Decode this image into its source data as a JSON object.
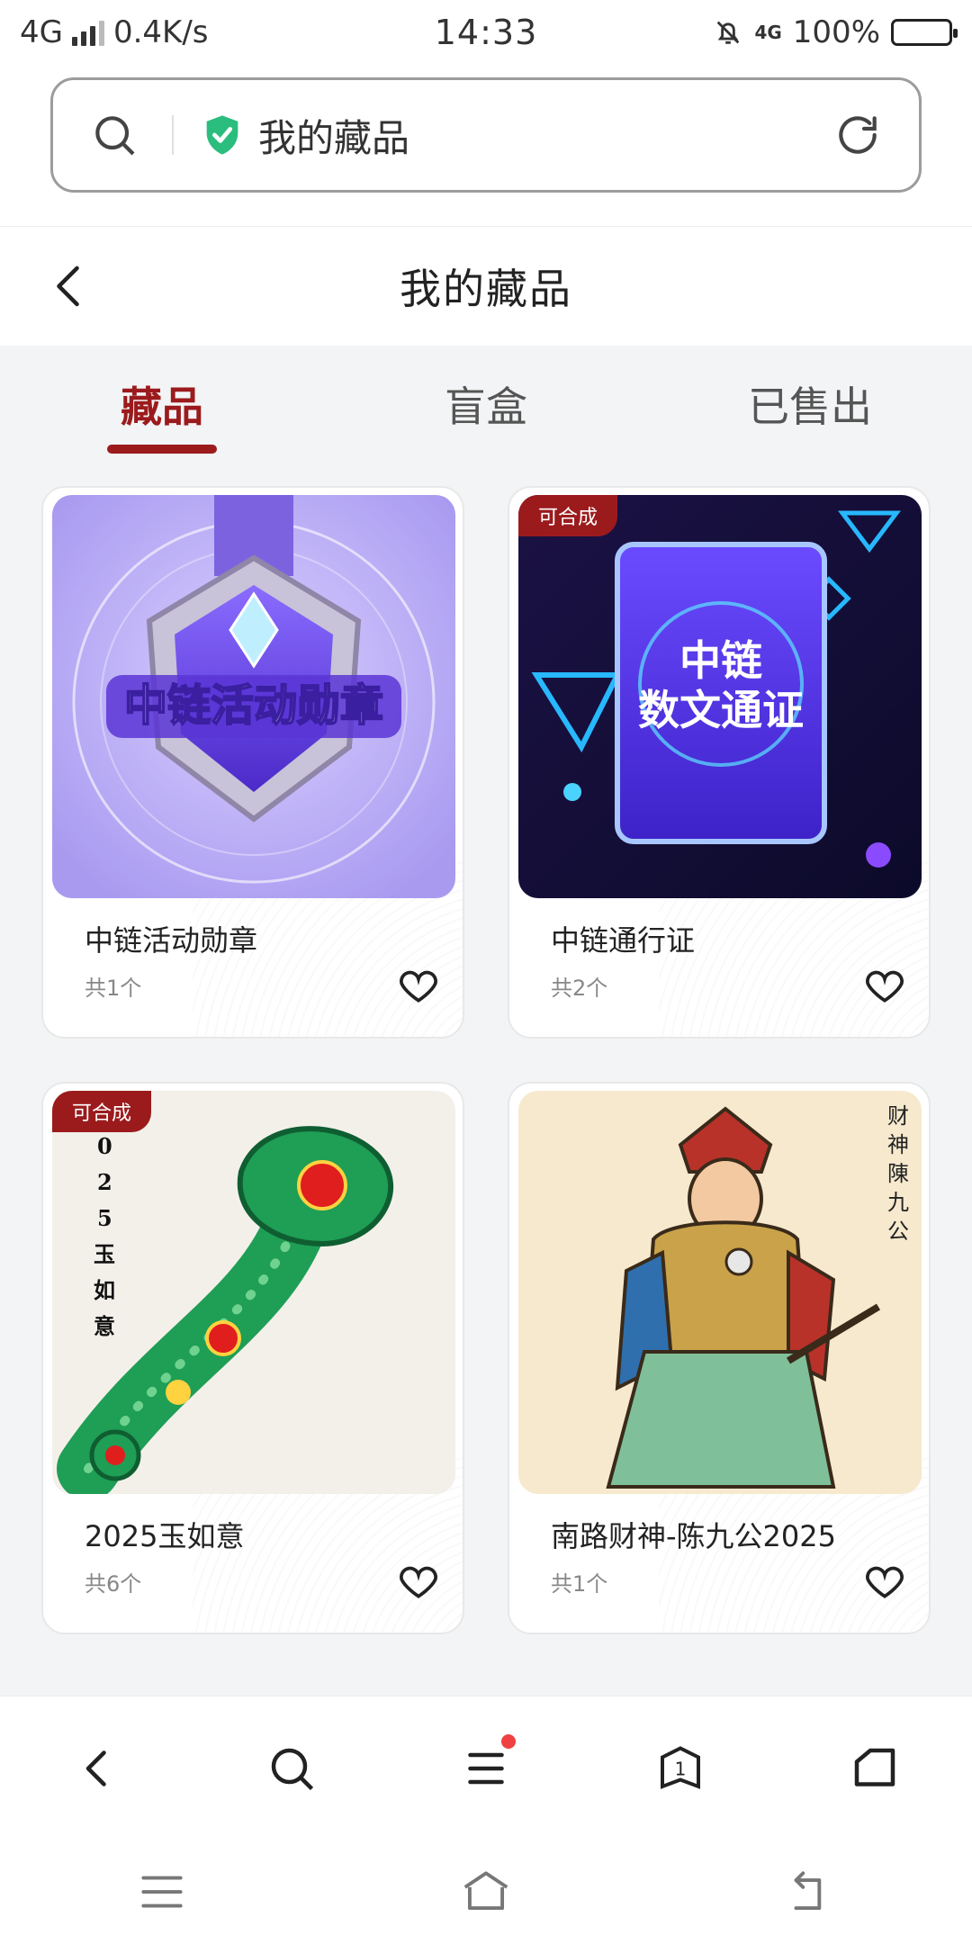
{
  "status_bar": {
    "network": "4G",
    "speed": "0.4K/s",
    "time": "14:33",
    "small_network": "4G",
    "battery": "100%"
  },
  "browser": {
    "address_text": "我的藏品",
    "icons": [
      "search-icon",
      "shield-check-icon",
      "refresh-icon"
    ]
  },
  "header": {
    "title": "我的藏品"
  },
  "tabs": [
    {
      "label": "藏品",
      "active": true
    },
    {
      "label": "盲盒",
      "active": false
    },
    {
      "label": "已售出",
      "active": false
    }
  ],
  "items": [
    {
      "name": "中链活动勋章",
      "count": "共1个",
      "badge": "",
      "image_text": "中链活动勋章"
    },
    {
      "name": "中链通行证",
      "count": "共2个",
      "badge": "可合成",
      "image_text_line1": "中链",
      "image_text_line2": "数文通证"
    },
    {
      "name": "2025玉如意",
      "count": "共6个",
      "badge": "可合成",
      "image_text": "0 2 5 玉 如 意"
    },
    {
      "name": "南路财神-陈九公2025",
      "count": "共1个",
      "badge": "",
      "image_text": "财神陳九公"
    }
  ],
  "toolbar": {
    "tab_count": "1",
    "icons": [
      "back-icon",
      "search-icon",
      "menu-icon",
      "tabs-icon",
      "home-icon"
    ]
  },
  "colors": {
    "accent": "#9b1b1d",
    "badge": "#9b1b1d",
    "notification_dot": "#f04142",
    "shield": "#2bbd7e"
  }
}
